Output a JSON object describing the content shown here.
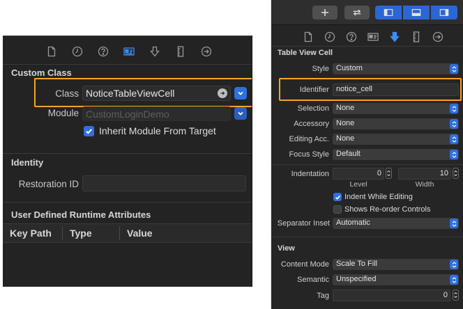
{
  "left_panel": {
    "custom_class": {
      "heading": "Custom Class",
      "class_label": "Class",
      "class_value": "NoticeTableViewCell",
      "module_label": "Module",
      "module_placeholder": "CustomLoginDemo",
      "inherit_label": "Inherit Module From Target",
      "inherit_checked": true
    },
    "identity": {
      "heading": "Identity",
      "restoration_label": "Restoration ID",
      "restoration_value": ""
    },
    "runtime_attributes": {
      "heading": "User Defined Runtime Attributes",
      "columns": [
        "Key Path",
        "Type",
        "Value"
      ]
    },
    "inspector_tabs": [
      "file-icon",
      "history-icon",
      "help-icon",
      "identity-icon",
      "attributes-icon",
      "size-icon",
      "connections-icon"
    ],
    "selected_tab": "identity-icon"
  },
  "right_panel": {
    "toolbar": [
      "add-icon",
      "swap-icon",
      "left-panel-icon",
      "bottom-panel-icon",
      "right-panel-icon"
    ],
    "inspector_tabs": [
      "file-icon",
      "history-icon",
      "help-icon",
      "identity-icon",
      "attributes-icon",
      "size-icon",
      "connections-icon"
    ],
    "selected_tab": "attributes-icon",
    "table_view_cell": {
      "heading": "Table View Cell",
      "style_label": "Style",
      "style_value": "Custom",
      "identifier_label": "Identifier",
      "identifier_value": "notice_cell",
      "selection_label": "Selection",
      "selection_value": "None",
      "accessory_label": "Accessory",
      "accessory_value": "None",
      "editing_acc_label": "Editing Acc.",
      "editing_acc_value": "None",
      "focus_style_label": "Focus Style",
      "focus_style_value": "Default",
      "indentation_label": "Indentation",
      "level_value": "0",
      "width_value": "10",
      "level_label": "Level",
      "width_label": "Width",
      "indent_while_editing_label": "Indent While Editing",
      "indent_while_editing_checked": true,
      "show_reorder_label": "Shows Re-order Controls",
      "show_reorder_checked": false,
      "separator_inset_label": "Separator Inset",
      "separator_inset_value": "Automatic"
    },
    "view": {
      "heading": "View",
      "content_mode_label": "Content Mode",
      "content_mode_value": "Scale To Fill",
      "semantic_label": "Semantic",
      "semantic_value": "Unspecified",
      "tag_label": "Tag",
      "tag_value": "0"
    }
  },
  "colors": {
    "accent": "#2f6fe2",
    "highlight": "#f5a623",
    "panel_bg": "#232323"
  }
}
